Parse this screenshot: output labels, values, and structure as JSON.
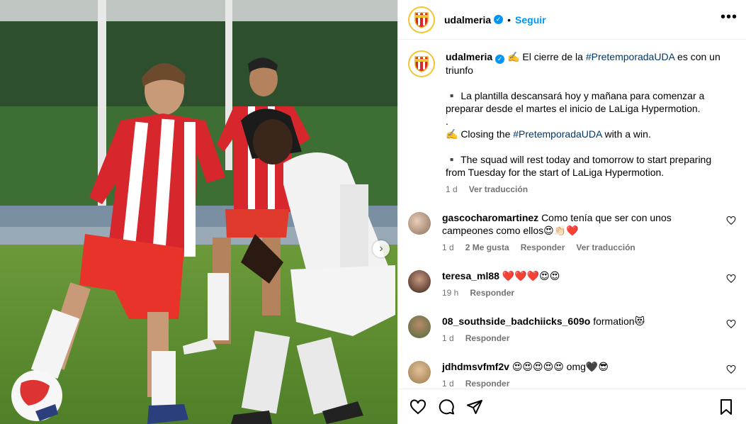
{
  "header": {
    "username": "udalmeria",
    "separator": "•",
    "follow_label": "Seguir",
    "more_label": "•••"
  },
  "caption": {
    "username": "udalmeria",
    "line1_pre": "✍️ El cierre de la ",
    "line1_hashtag": "#PretemporadaUDA",
    "line1_post": " es con un triunfo",
    "line2": "▪️ La plantilla descansará hoy y mañana para comenzar a preparar desde el martes el inicio de LaLiga Hypermotion.",
    "line3": ".",
    "line4_pre": "✍️ Closing the ",
    "line4_hashtag": "#PretemporadaUDA",
    "line4_post": " with a win.",
    "line5": "▪️ The squad will rest today and tomorrow to start preparing from Tuesday for the start of LaLiga Hypermotion.",
    "time": "1 d",
    "translate": "Ver traducción"
  },
  "comments": [
    {
      "username": "gascocharomartinez",
      "text": "Como tenía que ser con unos campeones como ellos😍👏🏻❤️",
      "time": "1 d",
      "likes": "2 Me gusta",
      "reply": "Responder",
      "translate": "Ver traducción"
    },
    {
      "username": "teresa_ml88",
      "text": "❤️❤️❤️😍😍",
      "time": "19 h",
      "reply": "Responder"
    },
    {
      "username": "08_southside_badchiicks_609o",
      "text": "formation😻",
      "time": "1 d",
      "reply": "Responder"
    },
    {
      "username": "jdhdmsvfmf2v",
      "text": "😍😍😍😍😍 omg🖤😎",
      "time": "1 d",
      "reply": "Responder"
    }
  ],
  "colors": {
    "accent": "#0095f6",
    "hashtag": "#00376b",
    "muted": "#737373",
    "kit_red": "#d8262d"
  },
  "icons": {
    "verified": "verified-badge-icon",
    "like": "heart-icon",
    "comment": "comment-icon",
    "share": "share-icon",
    "save": "bookmark-icon",
    "next": "chevron-right-icon"
  }
}
